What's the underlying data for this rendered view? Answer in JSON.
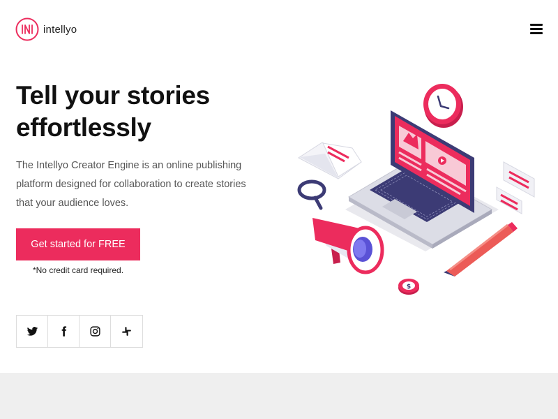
{
  "brand": {
    "name": "intellyo",
    "accent_color": "#ec2c5d"
  },
  "header": {
    "menu_icon": "hamburger-icon"
  },
  "hero": {
    "title_line1": "Tell your stories",
    "title_line2": "effortlessly",
    "description": "The Intellyo Creator Engine is an online publishing platform designed for collaboration to create stories that your audience loves.",
    "cta_label": "Get started for FREE",
    "cta_note": "*No credit card required."
  },
  "social": [
    {
      "icon": "twitter-icon"
    },
    {
      "icon": "facebook-icon"
    },
    {
      "icon": "instagram-icon"
    },
    {
      "icon": "slack-icon"
    }
  ],
  "illustration": {
    "description_icon": "laptop-publishing-illustration"
  }
}
